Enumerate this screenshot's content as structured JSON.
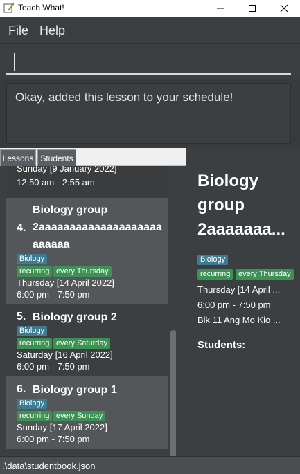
{
  "window": {
    "title": "Teach What!"
  },
  "menu": {
    "file": "File",
    "help": "Help"
  },
  "command": {
    "value": ""
  },
  "result": {
    "message": "Okay, added this lesson to your schedule!"
  },
  "tabs": {
    "lessons": "Lessons",
    "students": "Students"
  },
  "lessons": {
    "partial": {
      "date": "Sunday [9 January 2022]",
      "time": "12:50 am - 2:55 am"
    },
    "item4": {
      "index": "4.",
      "name_line1": "Biology group",
      "name_line2": "2aaaaaaaaaaaaaaaaaaaa",
      "name_line3": "aaaaaa",
      "subject": "Biology",
      "recurring": "recurring",
      "day": "every Thursday",
      "date": "Thursday [14 April 2022]",
      "time": "6:00 pm - 7:50 pm"
    },
    "item5": {
      "index": "5.",
      "name": "Biology group 2",
      "subject": "Biology",
      "recurring": "recurring",
      "day": "every Saturday",
      "date": "Saturday [16 April 2022]",
      "time": "6:00 pm - 7:50 pm"
    },
    "item6": {
      "index": "6.",
      "name": "Biology group 1",
      "subject": "Biology",
      "recurring": "recurring",
      "day": "every Sunday",
      "date": "Sunday [17 April 2022]",
      "time": "6:00 pm - 7:50 pm"
    }
  },
  "detail": {
    "name_line1": "Biology",
    "name_line2": "group",
    "name_line3": "2aaaaaaa...",
    "subject": "Biology",
    "recurring": "recurring",
    "day": "every Thursday",
    "date": "Thursday [14 April ...",
    "time": "6:00 pm - 7:50 pm",
    "venue": "Blk 11 Ang Mo Kio ...",
    "students_label": "Students:"
  },
  "status": {
    "path": ".\\data\\studentbook.json"
  },
  "colors": {
    "subject_tag": "#3e7b91",
    "recurring_tag": "#3e9155",
    "selected_card": "#545759"
  }
}
